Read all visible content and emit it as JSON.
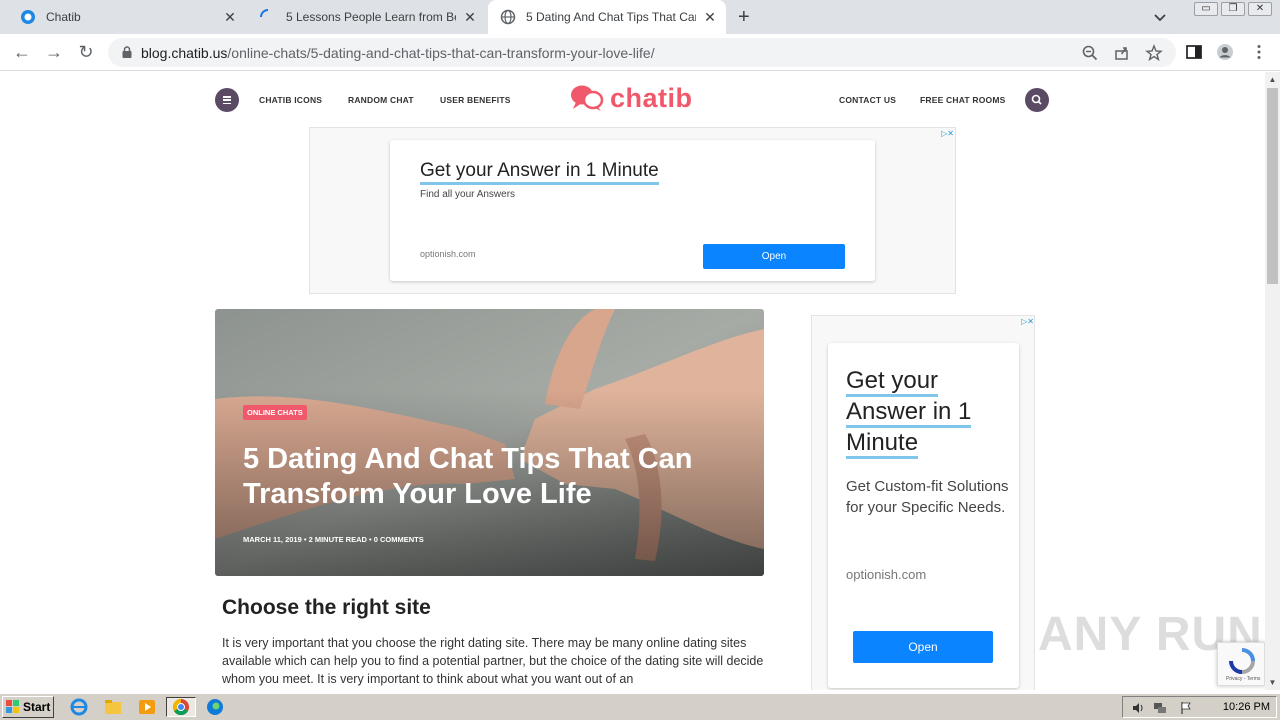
{
  "browser": {
    "tabs": [
      {
        "title": "Chatib",
        "active": false,
        "loading": false
      },
      {
        "title": "5 Lessons People Learn from Being in",
        "active": false,
        "loading": true
      },
      {
        "title": "5 Dating And Chat Tips That Can Tra",
        "active": true,
        "loading": false
      }
    ],
    "new_tab_label": "+",
    "url_host": "blog.chatib.us",
    "url_path": "/online-chats/5-dating-and-chat-tips-that-can-transform-your-love-life/"
  },
  "site": {
    "logo_text": "chatib",
    "nav_left": [
      "CHATIB ICONS",
      "RANDOM CHAT",
      "USER BENEFITS"
    ],
    "nav_right": [
      "CONTACT US",
      "FREE CHAT ROOMS"
    ],
    "accent_color": "#f0596b",
    "nav_button_color": "#5a4a63"
  },
  "ad_top": {
    "headline": "Get your Answer in 1 Minute",
    "subtext": "Find all your Answers",
    "domain": "optionish.com",
    "button": "Open"
  },
  "hero": {
    "category": "ONLINE CHATS",
    "title": "5 Dating And Chat Tips That Can Transform Your Love Life",
    "meta": "MARCH 11, 2019  •  2 MINUTE READ  •  0 COMMENTS"
  },
  "article": {
    "heading": "Choose the right site",
    "paragraph": "It is very important that you choose the right dating site. There may be many online dating sites available which can help you to find a potential partner, but the choice of the dating site will decide whom you meet. It is very important to think about what you want out of an"
  },
  "ad_side": {
    "headline_lines": [
      "Get your",
      "Answer in 1",
      "Minute"
    ],
    "subtext": "Get Custom-fit Solutions for your Specific Needs.",
    "domain": "optionish.com",
    "button": "Open"
  },
  "recaptcha_text": "Privacy - Terms",
  "watermark": "ANY RUN",
  "taskbar": {
    "start_label": "Start",
    "clock": "10:26 PM"
  }
}
